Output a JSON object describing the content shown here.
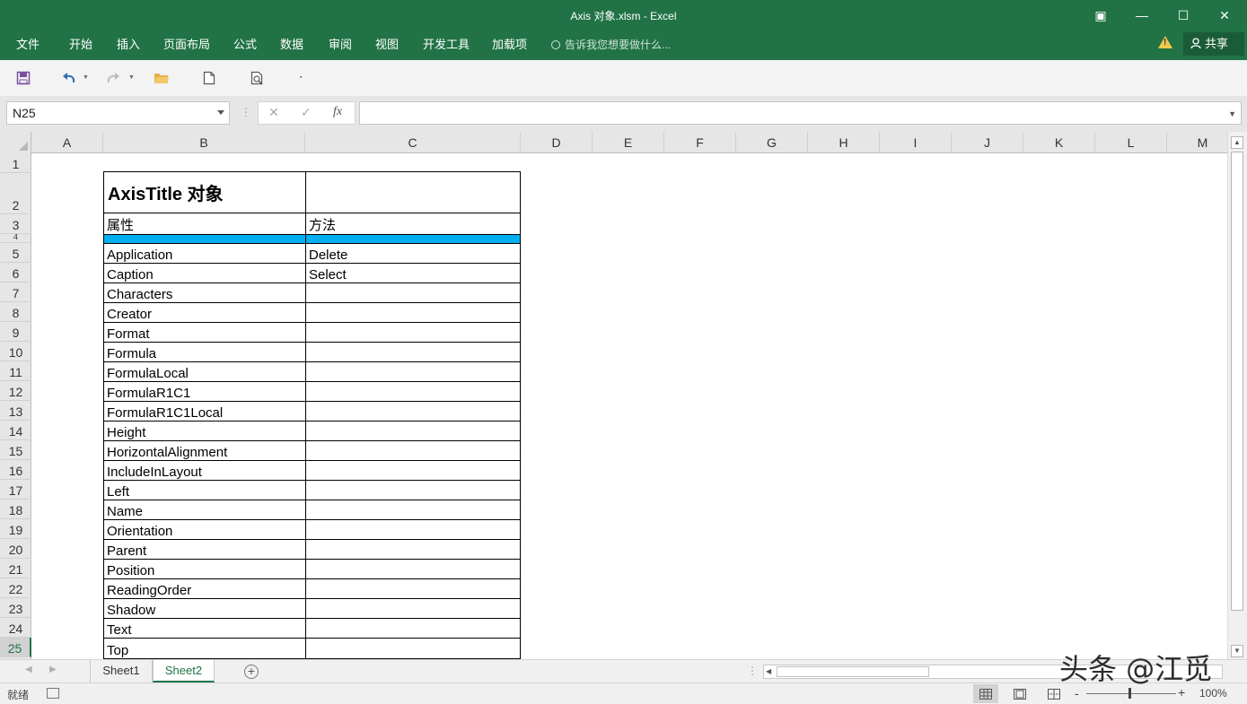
{
  "window": {
    "title": "Axis 对象.xlsm - Excel",
    "restore_glyph": "▣",
    "minimize_glyph": "—",
    "maximize_glyph": "☐",
    "close_glyph": "✕"
  },
  "menu": {
    "items": [
      "文件",
      "开始",
      "插入",
      "页面布局",
      "公式",
      "数据",
      "审阅",
      "视图",
      "开发工具",
      "加载项"
    ],
    "tell_me": "告诉我您想要做什么...",
    "share": "共享"
  },
  "quick_access": {
    "icons": [
      "save-icon",
      "undo-icon",
      "redo-icon",
      "open-folder-icon",
      "new-document-icon",
      "print-preview-icon"
    ],
    "accent": "#217346"
  },
  "formula_bar": {
    "name_box": "N25",
    "formula": "",
    "cancel_glyph": "✕",
    "enter_glyph": "✓",
    "fx_glyph": "fx"
  },
  "grid": {
    "columns": [
      "A",
      "B",
      "C",
      "D",
      "E",
      "F",
      "G",
      "H",
      "I",
      "J",
      "K",
      "L",
      "M"
    ],
    "rows": [
      "1",
      "2",
      "3",
      "4",
      "5",
      "6",
      "7",
      "8",
      "9",
      "10",
      "11",
      "12",
      "13",
      "14",
      "15",
      "16",
      "17",
      "18",
      "19",
      "20",
      "21",
      "22",
      "23",
      "24",
      "25"
    ],
    "selected_row": "25",
    "band_color": "#00b0f0"
  },
  "table": {
    "title": "AxisTitle 对象",
    "property_header": "属性",
    "method_header": "方法",
    "properties": [
      "Application",
      "Caption",
      "Characters",
      "Creator",
      "Format",
      "Formula",
      "FormulaLocal",
      "FormulaR1C1",
      "FormulaR1C1Local",
      "Height",
      "HorizontalAlignment",
      "IncludeInLayout",
      "Left",
      "Name",
      "Orientation",
      "Parent",
      "Position",
      "ReadingOrder",
      "Shadow",
      "Text",
      "Top"
    ],
    "methods": [
      "Delete",
      "Select"
    ]
  },
  "sheets": {
    "tabs": [
      "Sheet1",
      "Sheet2"
    ],
    "active": "Sheet2",
    "add_glyph": "+"
  },
  "status": {
    "ready": "就绪",
    "zoom": "100%",
    "zoom_minus": "-",
    "zoom_plus": "+"
  },
  "watermark": "头条 @江觅"
}
